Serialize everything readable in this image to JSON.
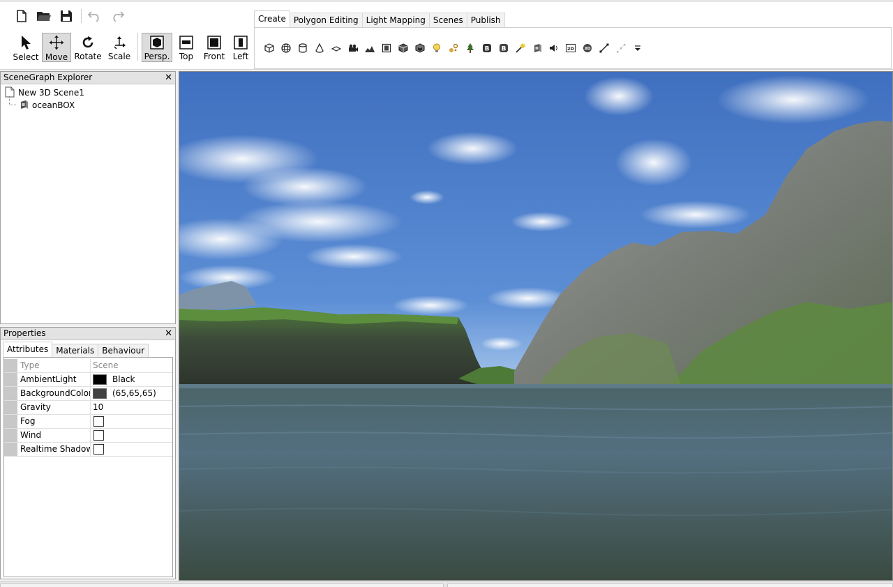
{
  "quick_access": {
    "items": [
      "new-file-icon",
      "open-folder-icon",
      "save-icon",
      "undo-icon",
      "redo-icon"
    ]
  },
  "tools": [
    {
      "label": "Select",
      "icon": "cursor-arrow-icon"
    },
    {
      "label": "Move",
      "icon": "move-arrows-icon"
    },
    {
      "label": "Rotate",
      "icon": "rotate-icon"
    },
    {
      "label": "Scale",
      "icon": "scale-icon"
    },
    {
      "label": "Persp.",
      "icon": "perspective-view-icon"
    },
    {
      "label": "Top",
      "icon": "top-view-icon"
    },
    {
      "label": "Front",
      "icon": "front-view-icon"
    },
    {
      "label": "Left",
      "icon": "left-view-icon"
    }
  ],
  "ribbon": {
    "tabs": [
      "Create",
      "Polygon Editing",
      "Light Mapping",
      "Scenes",
      "Publish"
    ],
    "create_icons": [
      "cube-icon",
      "sphere-icon",
      "cylinder-icon",
      "cone-icon",
      "plane-icon",
      "camera-icon",
      "terrain-icon",
      "billboard-icon",
      "mesh-icon",
      "mesh-group-icon",
      "light-bulb-icon",
      "particle-icon",
      "tree-icon",
      "button-b-icon",
      "button-b2-icon",
      "sun-icon",
      "skybox-icon",
      "sound-icon",
      "2d-overlay-icon",
      "3d-overlay-icon",
      "path-icon",
      "path-points-icon",
      "more-dropdown-icon"
    ]
  },
  "scene_panel": {
    "title": "SceneGraph Explorer",
    "root": "New 3D Scene1",
    "child": "oceanBOX"
  },
  "properties": {
    "title": "Properties",
    "tabs": [
      "Attributes",
      "Materials",
      "Behaviour"
    ],
    "header": {
      "name": "Type",
      "value": "Scene"
    },
    "rows": [
      {
        "name": "AmbientLight",
        "value": "Black",
        "kind": "color",
        "color": "#000000"
      },
      {
        "name": "BackgroundColor",
        "value": "(65,65,65)",
        "kind": "color",
        "color": "#414141"
      },
      {
        "name": "Gravity",
        "value": "10",
        "kind": "text"
      },
      {
        "name": "Fog",
        "value": "",
        "kind": "checkbox"
      },
      {
        "name": "Wind",
        "value": "",
        "kind": "checkbox"
      },
      {
        "name": "Realtime Shadows",
        "value": "",
        "kind": "checkbox"
      }
    ]
  }
}
